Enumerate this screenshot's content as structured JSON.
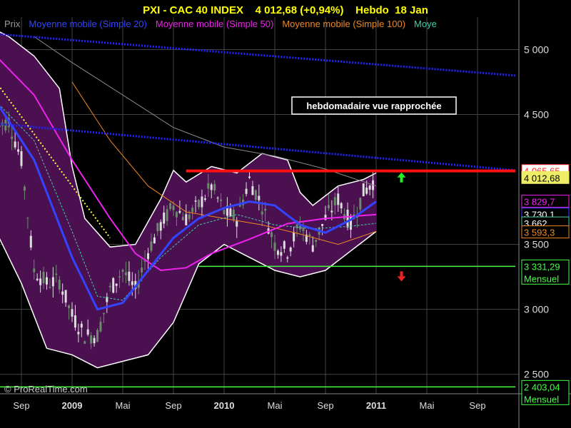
{
  "header": {
    "title": "PXI - CAC 40 INDEX    4 012,68 (+0,94%)    Hebdo  18 Jan"
  },
  "legend": [
    {
      "label": "Prix",
      "color": "#9a9a9a"
    },
    {
      "label": "Moyenne mobile (Simple 20)",
      "color": "#3344ff"
    },
    {
      "label": "Moyenne mobile (Simple 50)",
      "color": "#ee22ee"
    },
    {
      "label": "Moyenne mobile (Simple 100)",
      "color": "#ee8822"
    },
    {
      "label": "Moye",
      "color": "#44ccaa"
    }
  ],
  "annotation": "hebdomadaire vue rapprochée",
  "watermark": "© ProRealTime.com",
  "colors": {
    "background": "#000000",
    "band_fill": "#4a1050",
    "band_edge": "#ffffff",
    "candle_up": "#dddddd",
    "candle_down": "#6a8a6a",
    "ma20": "#3344ff",
    "ma50": "#ee22ee",
    "ma100": "#ee8822",
    "ma_cyan": "#44ccaa",
    "resistance": "#ff1111",
    "support": "#44ff44",
    "dotted_blue": "#2222ff",
    "dotted_yellow": "#ffff44",
    "grid": "#444444"
  },
  "chart_data": {
    "type": "line",
    "title": "PXI - CAC 40 INDEX    4 012,68 (+0,94%)    Hebdo  18 Jan",
    "ylim": [
      2350,
      5250
    ],
    "y_ticks": [
      {
        "value": 5000,
        "label": "5 000"
      },
      {
        "value": 4500,
        "label": "4 500"
      },
      {
        "value": 3500,
        "label": "3 500"
      },
      {
        "value": 3000,
        "label": "3 000"
      },
      {
        "value": 2500,
        "label": "2 500"
      }
    ],
    "x_ticks": [
      {
        "date": "2008-09",
        "label": "Sep",
        "bold": false
      },
      {
        "date": "2009-01",
        "label": "2009",
        "bold": true
      },
      {
        "date": "2009-05",
        "label": "Mai",
        "bold": false
      },
      {
        "date": "2009-09",
        "label": "Sep",
        "bold": false
      },
      {
        "date": "2010-01",
        "label": "2010",
        "bold": true
      },
      {
        "date": "2010-05",
        "label": "Mai",
        "bold": false
      },
      {
        "date": "2010-09",
        "label": "Sep",
        "bold": false
      },
      {
        "date": "2011-01",
        "label": "2011",
        "bold": true
      },
      {
        "date": "2011-05",
        "label": "Mai",
        "bold": false
      },
      {
        "date": "2011-09",
        "label": "Sep",
        "bold": false
      }
    ],
    "price_badges": [
      {
        "value": 4065.65,
        "label": "4 065,65",
        "bg": "#ffffff",
        "fg": "#ff2222",
        "border": "#ff2222"
      },
      {
        "value": 4012.68,
        "label": "4 012,68",
        "bg": "#eeee66",
        "fg": "#000000",
        "border": "#eeee66"
      },
      {
        "value": 3829.7,
        "label": "3 829,7",
        "bg": "#000000",
        "fg": "#ee22ee",
        "border": "#ee22ee"
      },
      {
        "value": 3730.1,
        "label": "3 730,1",
        "bg": "#000000",
        "fg": "#ffffff",
        "border": "#3344ff"
      },
      {
        "value": 3662,
        "label": "3 662",
        "bg": "#000000",
        "fg": "#ffffff",
        "border": "#44ccaa"
      },
      {
        "value": 3593.3,
        "label": "3 593,3",
        "bg": "#000000",
        "fg": "#ee8822",
        "border": "#ee8822"
      },
      {
        "value": 3331.29,
        "label": "3 331,29",
        "bg": "#000000",
        "fg": "#44ff44",
        "border": "#44ff44",
        "sub": "Mensuel"
      },
      {
        "value": 2403.04,
        "label": "2 403,04",
        "bg": "#000000",
        "fg": "#44ff44",
        "border": "#44ff44",
        "sub": "Mensuel"
      }
    ],
    "close_series": [
      {
        "x": "2008-07",
        "y": 4400
      },
      {
        "x": "2008-08",
        "y": 4450
      },
      {
        "x": "2008-09",
        "y": 4150
      },
      {
        "x": "2008-10",
        "y": 3300
      },
      {
        "x": "2008-11",
        "y": 3200
      },
      {
        "x": "2008-12",
        "y": 3220
      },
      {
        "x": "2009-01",
        "y": 2950
      },
      {
        "x": "2009-02",
        "y": 2800
      },
      {
        "x": "2009-03",
        "y": 2800
      },
      {
        "x": "2009-04",
        "y": 3150
      },
      {
        "x": "2009-05",
        "y": 3300
      },
      {
        "x": "2009-06",
        "y": 3150
      },
      {
        "x": "2009-07",
        "y": 3450
      },
      {
        "x": "2009-08",
        "y": 3650
      },
      {
        "x": "2009-09",
        "y": 3800
      },
      {
        "x": "2009-10",
        "y": 3700
      },
      {
        "x": "2009-11",
        "y": 3800
      },
      {
        "x": "2009-12",
        "y": 3950
      },
      {
        "x": "2010-01",
        "y": 3750
      },
      {
        "x": "2010-02",
        "y": 3700
      },
      {
        "x": "2010-03",
        "y": 4000
      },
      {
        "x": "2010-04",
        "y": 3800
      },
      {
        "x": "2010-05",
        "y": 3500
      },
      {
        "x": "2010-06",
        "y": 3450
      },
      {
        "x": "2010-07",
        "y": 3650
      },
      {
        "x": "2010-08",
        "y": 3500
      },
      {
        "x": "2010-09",
        "y": 3700
      },
      {
        "x": "2010-10",
        "y": 3850
      },
      {
        "x": "2010-11",
        "y": 3650
      },
      {
        "x": "2010-12",
        "y": 3900
      },
      {
        "x": "2011-01",
        "y": 4012.68
      }
    ],
    "ma20": [
      {
        "x": "2008-07",
        "y": 4600
      },
      {
        "x": "2008-10",
        "y": 4150
      },
      {
        "x": "2009-01",
        "y": 3400
      },
      {
        "x": "2009-03",
        "y": 3000
      },
      {
        "x": "2009-05",
        "y": 3050
      },
      {
        "x": "2009-07",
        "y": 3300
      },
      {
        "x": "2009-09",
        "y": 3550
      },
      {
        "x": "2009-11",
        "y": 3700
      },
      {
        "x": "2010-01",
        "y": 3780
      },
      {
        "x": "2010-03",
        "y": 3830
      },
      {
        "x": "2010-05",
        "y": 3800
      },
      {
        "x": "2010-07",
        "y": 3650
      },
      {
        "x": "2010-09",
        "y": 3590
      },
      {
        "x": "2010-11",
        "y": 3690
      },
      {
        "x": "2011-01",
        "y": 3830
      }
    ],
    "ma50": [
      {
        "x": "2008-07",
        "y": 4950
      },
      {
        "x": "2008-10",
        "y": 4650
      },
      {
        "x": "2009-01",
        "y": 4150
      },
      {
        "x": "2009-04",
        "y": 3700
      },
      {
        "x": "2009-06",
        "y": 3430
      },
      {
        "x": "2009-08",
        "y": 3300
      },
      {
        "x": "2009-10",
        "y": 3320
      },
      {
        "x": "2009-12",
        "y": 3430
      },
      {
        "x": "2010-03",
        "y": 3540
      },
      {
        "x": "2010-06",
        "y": 3660
      },
      {
        "x": "2010-09",
        "y": 3700
      },
      {
        "x": "2011-01",
        "y": 3730
      }
    ],
    "ma100": [
      {
        "x": "2009-01",
        "y": 4750
      },
      {
        "x": "2009-04",
        "y": 4300
      },
      {
        "x": "2009-07",
        "y": 3950
      },
      {
        "x": "2009-10",
        "y": 3750
      },
      {
        "x": "2010-01",
        "y": 3700
      },
      {
        "x": "2010-04",
        "y": 3650
      },
      {
        "x": "2010-07",
        "y": 3580
      },
      {
        "x": "2010-10",
        "y": 3500
      },
      {
        "x": "2011-01",
        "y": 3600
      }
    ],
    "ma_cyan": [
      {
        "x": "2008-07",
        "y": 4600
      },
      {
        "x": "2008-10",
        "y": 4300
      },
      {
        "x": "2009-01",
        "y": 3600
      },
      {
        "x": "2009-03",
        "y": 3100
      },
      {
        "x": "2009-05",
        "y": 3070
      },
      {
        "x": "2009-08",
        "y": 3400
      },
      {
        "x": "2009-11",
        "y": 3650
      },
      {
        "x": "2010-02",
        "y": 3730
      },
      {
        "x": "2010-05",
        "y": 3650
      },
      {
        "x": "2010-08",
        "y": 3620
      },
      {
        "x": "2010-11",
        "y": 3640
      },
      {
        "x": "2011-01",
        "y": 3662
      }
    ],
    "long_ma": [
      {
        "x": "2008-10",
        "y": 5100
      },
      {
        "x": "2009-01",
        "y": 4900
      },
      {
        "x": "2009-05",
        "y": 4650
      },
      {
        "x": "2009-09",
        "y": 4400
      },
      {
        "x": "2010-01",
        "y": 4250
      },
      {
        "x": "2010-05",
        "y": 4180
      },
      {
        "x": "2010-09",
        "y": 4080
      },
      {
        "x": "2011-01",
        "y": 3950
      }
    ],
    "band_upper": [
      {
        "x": "2008-07",
        "y": 5150
      },
      {
        "x": "2008-08",
        "y": 5100
      },
      {
        "x": "2008-10",
        "y": 4950
      },
      {
        "x": "2008-12",
        "y": 4700
      },
      {
        "x": "2009-01",
        "y": 4100
      },
      {
        "x": "2009-02",
        "y": 3700
      },
      {
        "x": "2009-04",
        "y": 3480
      },
      {
        "x": "2009-06",
        "y": 3500
      },
      {
        "x": "2009-08",
        "y": 3850
      },
      {
        "x": "2009-09",
        "y": 4070
      },
      {
        "x": "2009-10",
        "y": 3980
      },
      {
        "x": "2009-12",
        "y": 4100
      },
      {
        "x": "2010-02",
        "y": 4050
      },
      {
        "x": "2010-04",
        "y": 4200
      },
      {
        "x": "2010-06",
        "y": 4150
      },
      {
        "x": "2010-07",
        "y": 3900
      },
      {
        "x": "2010-08",
        "y": 3800
      },
      {
        "x": "2010-10",
        "y": 3950
      },
      {
        "x": "2010-12",
        "y": 4000
      },
      {
        "x": "2011-01",
        "y": 4050
      }
    ],
    "band_lower": [
      {
        "x": "2008-07",
        "y": 3600
      },
      {
        "x": "2008-09",
        "y": 3200
      },
      {
        "x": "2008-11",
        "y": 2700
      },
      {
        "x": "2009-01",
        "y": 2650
      },
      {
        "x": "2009-03",
        "y": 2550
      },
      {
        "x": "2009-05",
        "y": 2600
      },
      {
        "x": "2009-07",
        "y": 2650
      },
      {
        "x": "2009-09",
        "y": 2900
      },
      {
        "x": "2009-11",
        "y": 3350
      },
      {
        "x": "2010-01",
        "y": 3500
      },
      {
        "x": "2010-03",
        "y": 3400
      },
      {
        "x": "2010-05",
        "y": 3300
      },
      {
        "x": "2010-07",
        "y": 3250
      },
      {
        "x": "2010-09",
        "y": 3300
      },
      {
        "x": "2010-11",
        "y": 3450
      },
      {
        "x": "2011-01",
        "y": 3600
      }
    ],
    "trendlines": [
      {
        "style": "dotted-blue",
        "from": {
          "x": "2008-07",
          "y": 5120
        },
        "to": {
          "x": "2011-12",
          "y": 4800
        }
      },
      {
        "style": "dotted-blue",
        "from": {
          "x": "2008-07",
          "y": 4430
        },
        "to": {
          "x": "2011-12",
          "y": 4070
        }
      },
      {
        "style": "dotted-yellow",
        "from": {
          "x": "2008-07",
          "y": 4750
        },
        "to": {
          "x": "2009-04",
          "y": 3550
        }
      }
    ],
    "levels": [
      {
        "style": "resistance",
        "value": 4065.65,
        "from": "2009-10",
        "to": "2011-12"
      },
      {
        "style": "support",
        "value": 3331.29,
        "from": "2009-11",
        "to": "2011-12"
      },
      {
        "style": "support",
        "value": 2403.04,
        "from": "2008-07",
        "to": "2011-12"
      }
    ],
    "arrows": [
      {
        "direction": "up",
        "x": "2011-03",
        "y": 4010,
        "color": "#22ee22"
      },
      {
        "direction": "down",
        "x": "2011-03",
        "y": 3260,
        "color": "#ee2222"
      }
    ]
  }
}
